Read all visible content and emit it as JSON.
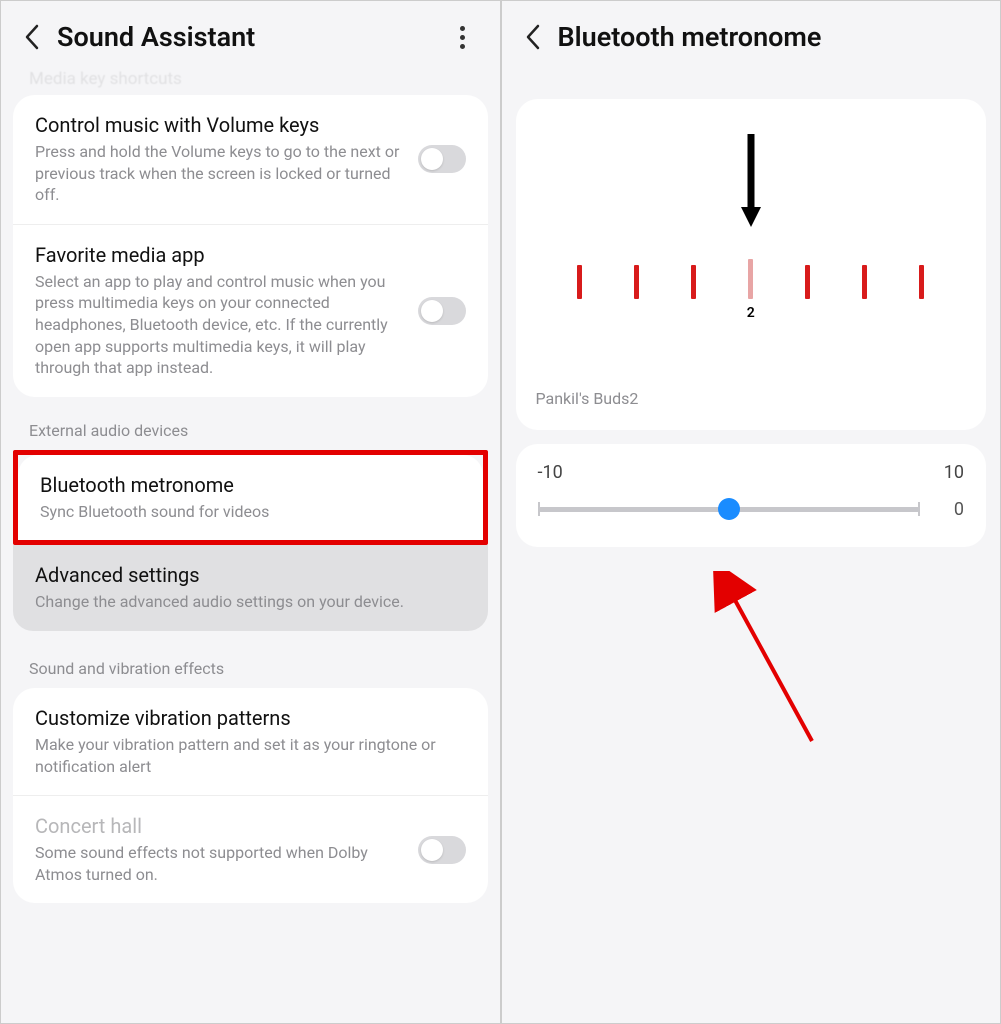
{
  "left": {
    "title": "Sound Assistant",
    "fadedTop": "Media key shortcuts",
    "items": [
      {
        "title": "Control music with Volume keys",
        "desc": "Press and hold the Volume keys to go to the next or previous track when the screen is locked or turned off."
      },
      {
        "title": "Favorite media app",
        "desc": "Select an app to play and control music when you press multimedia keys on your connected headphones, Bluetooth device, etc. If the currently open app supports multimedia keys, it will play through that app instead."
      }
    ],
    "sectionExternal": "External audio devices",
    "bluetoothMetronome": {
      "title": "Bluetooth metronome",
      "desc": "Sync Bluetooth sound for videos"
    },
    "advanced": {
      "title": "Advanced settings",
      "desc": "Change the advanced audio settings on your device."
    },
    "sectionSound": "Sound and vibration effects",
    "customize": {
      "title": "Customize vibration patterns",
      "desc": "Make your vibration pattern and set it as your ringtone or notification alert"
    },
    "concert": {
      "title": "Concert hall",
      "desc": "Some sound effects not supported when Dolby Atmos turned on."
    }
  },
  "right": {
    "title": "Bluetooth metronome",
    "tickValue": "2",
    "deviceName": "Pankil's Buds2",
    "slider": {
      "min": "-10",
      "max": "10",
      "value": "0"
    }
  }
}
